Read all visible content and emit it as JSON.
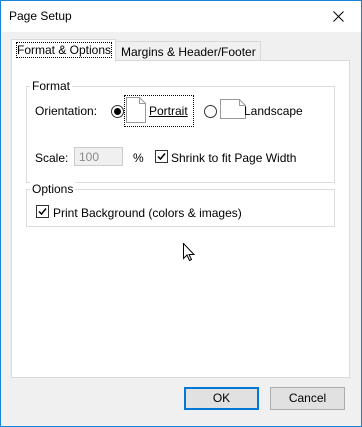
{
  "window": {
    "title": "Page Setup"
  },
  "tabs": [
    {
      "label": "Format & Options",
      "active": true
    },
    {
      "label": "Margins & Header/Footer",
      "active": false
    }
  ],
  "format_group": {
    "title": "Format",
    "orientation_label": "Orientation:",
    "portrait_label": "Portrait",
    "landscape_label": "Landscape",
    "selected_orientation": "Portrait",
    "scale_label": "Scale:",
    "scale_value": "100",
    "percent_label": "%",
    "shrink_label": "Shrink to fit Page Width",
    "shrink_checked": true
  },
  "options_group": {
    "title": "Options",
    "print_background_label": "Print Background (colors & images)",
    "print_background_checked": true
  },
  "buttons": {
    "ok_label": "OK",
    "cancel_label": "Cancel"
  },
  "colors": {
    "window_border": "#1883d7",
    "default_button_border": "#0078d7",
    "dialog_background": "#f0f0f0"
  }
}
